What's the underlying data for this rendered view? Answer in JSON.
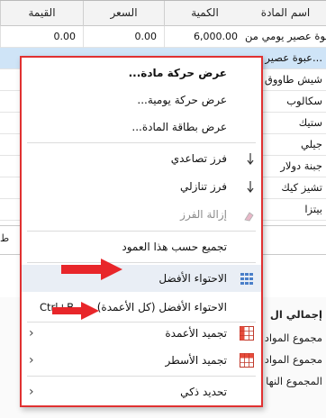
{
  "grid": {
    "headers": [
      "اسم المادة",
      "الكمية",
      "السعر",
      "القيمة"
    ],
    "rows": [
      {
        "name": "عبوة عصير يومي من...",
        "qty": "6,000.00",
        "price": "0.00",
        "value": "0.00",
        "selected": false
      },
      {
        "name": "عبوة عصير يو...",
        "qty": "",
        "price": "",
        "value": "",
        "selected": true
      },
      {
        "name": "شيش طاووق",
        "qty": "",
        "price": "",
        "value": "",
        "selected": false
      },
      {
        "name": "سكالوب",
        "qty": "",
        "price": "",
        "value": "",
        "selected": false
      },
      {
        "name": "ستيك",
        "qty": "",
        "price": "",
        "value": "",
        "selected": false
      },
      {
        "name": "جيلي",
        "qty": "",
        "price": "",
        "value": "",
        "selected": false
      },
      {
        "name": "جبنة دولار",
        "qty": "",
        "price": "",
        "value": "",
        "selected": false
      },
      {
        "name": "تشيز كيك",
        "qty": "",
        "price": "",
        "value": "",
        "selected": false
      },
      {
        "name": "بيتزا",
        "qty": "",
        "price": "",
        "value": "",
        "selected": false
      }
    ]
  },
  "mid_text": "ط",
  "bottom_panel": {
    "title": "إجمالي ال",
    "rows": [
      "مجموع المواد",
      "مجموع المواد",
      "المجموع النها"
    ]
  },
  "context_menu": {
    "items": [
      {
        "label": "عرض حركة مادة...",
        "bold": true
      },
      {
        "label": "عرض حركة يومية..."
      },
      {
        "label": "عرض بطاقة المادة..."
      },
      {
        "label": "فرز تصاعدي",
        "icon": "sort-ascending-icon"
      },
      {
        "label": "فرز تنازلي",
        "icon": "sort-descending-icon"
      },
      {
        "label": "إزالة الفرز",
        "icon": "clear-sort-icon",
        "disabled": true
      },
      {
        "label": "تجميع حسب هذا العمود"
      },
      {
        "label": "الاحتواء الأفضل",
        "icon": "best-fit-icon",
        "highlighted": true
      },
      {
        "label": "الاحتواء الأفضل (كل الأعمدة)",
        "shortcut": "Ctrl+B"
      },
      {
        "label": "تجميد الأعمدة",
        "icon": "freeze-columns-icon",
        "submenu": true
      },
      {
        "label": "تجميد الأسطر",
        "icon": "freeze-rows-icon",
        "submenu": true
      },
      {
        "label": "تحديد ذكي",
        "submenu": true
      }
    ]
  },
  "colors": {
    "menu_border": "#e03131",
    "arrow": "#e8262a",
    "selection": "#cfe4f7",
    "highlight": "#e9eef5"
  }
}
